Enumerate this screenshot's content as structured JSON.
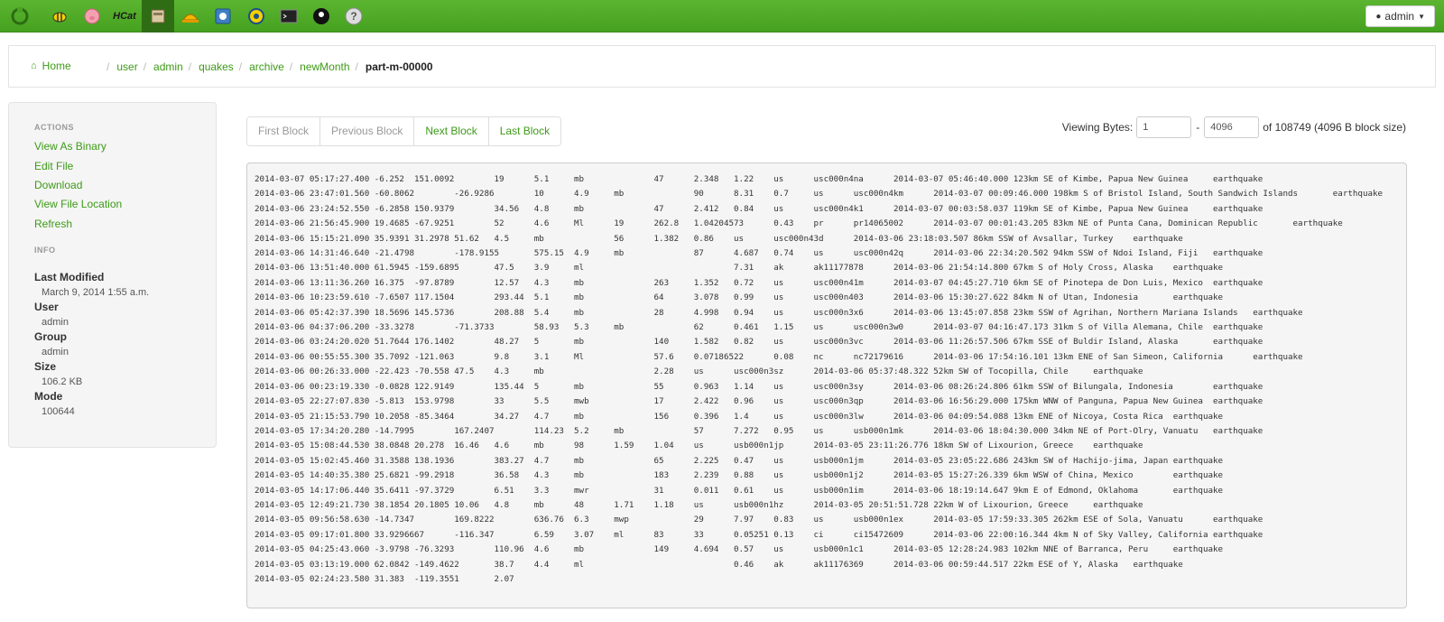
{
  "topbar": {
    "apps": [
      {
        "name": "hue-logo-icon"
      },
      {
        "name": "hive-bee-icon"
      },
      {
        "name": "pig-icon"
      },
      {
        "name": "hcat-icon",
        "label": "HCat"
      },
      {
        "name": "file-browser-icon"
      },
      {
        "name": "job-designer-icon"
      },
      {
        "name": "oozie-icon"
      },
      {
        "name": "job-browser-icon"
      },
      {
        "name": "shell-icon"
      },
      {
        "name": "user-admin-icon"
      },
      {
        "name": "help-icon"
      }
    ],
    "user_label": "admin"
  },
  "breadcrumb": {
    "home": "Home",
    "parts": [
      "user",
      "admin",
      "quakes",
      "archive",
      "newMonth"
    ],
    "current": "part-m-00000"
  },
  "sidebar": {
    "actions_heading": "ACTIONS",
    "actions": [
      "View As Binary",
      "Edit File",
      "Download",
      "View File Location",
      "Refresh"
    ],
    "info_heading": "INFO",
    "info": [
      {
        "label": "Last Modified",
        "value": "March 9, 2014 1:55 a.m."
      },
      {
        "label": "User",
        "value": "admin"
      },
      {
        "label": "Group",
        "value": "admin"
      },
      {
        "label": "Size",
        "value": "106.2 KB"
      },
      {
        "label": "Mode",
        "value": "100644"
      }
    ]
  },
  "pager": {
    "first": "First Block",
    "previous": "Previous Block",
    "next": "Next Block",
    "last": "Last Block"
  },
  "viewing": {
    "label": "Viewing Bytes:",
    "from": "1",
    "to": "4096",
    "suffix": "of 108749 (4096 B block size)"
  },
  "file_content": "2014-03-07 05:17:27.400 -6.252  151.0092        19      5.1     mb              47      2.348   1.22    us      usc000n4na      2014-03-07 05:46:40.000 123km SE of Kimbe, Papua New Guinea     earthquake\n2014-03-06 23:47:01.560 -60.8062        -26.9286        10      4.9     mb              90      8.31    0.7     us      usc000n4km      2014-03-07 00:09:46.000 198km S of Bristol Island, South Sandwich Islands       earthquake\n2014-03-06 23:24:52.550 -6.2858 150.9379        34.56   4.8     mb              47      2.412   0.84    us      usc000n4k1      2014-03-07 00:03:58.037 119km SE of Kimbe, Papua New Guinea     earthquake\n2014-03-06 21:56:45.900 19.4685 -67.9251        52      4.6     Ml      19      262.8   1.04204573      0.43    pr      pr14065002      2014-03-07 00:01:43.205 83km NE of Punta Cana, Dominican Republic       earthquake\n2014-03-06 15:15:21.090 35.9391 31.2978 51.62   4.5     mb              56      1.382   0.86    us      usc000n43d      2014-03-06 23:18:03.507 86km SSW of Avsallar, Turkey    earthquake\n2014-03-06 14:31:46.640 -21.4798        -178.9155       575.15  4.9     mb              87      4.687   0.74    us      usc000n42q      2014-03-06 22:34:20.502 94km SSW of Ndoi Island, Fiji   earthquake\n2014-03-06 13:51:40.000 61.5945 -159.6895       47.5    3.9     ml                              7.31    ak      ak11177878      2014-03-06 21:54:14.800 67km S of Holy Cross, Alaska    earthquake\n2014-03-06 13:11:36.260 16.375  -97.8789        12.57   4.3     mb              263     1.352   0.72    us      usc000n41m      2014-03-07 04:45:27.710 6km SE of Pinotepa de Don Luis, Mexico  earthquake\n2014-03-06 10:23:59.610 -7.6507 117.1504        293.44  5.1     mb              64      3.078   0.99    us      usc000n403      2014-03-06 15:30:27.622 84km N of Utan, Indonesia       earthquake\n2014-03-06 05:42:37.390 18.5696 145.5736        208.88  5.4     mb              28      4.998   0.94    us      usc000n3x6      2014-03-06 13:45:07.858 23km SSW of Agrihan, Northern Mariana Islands   earthquake\n2014-03-06 04:37:06.200 -33.3278        -71.3733        58.93   5.3     mb              62      0.461   1.15    us      usc000n3w0      2014-03-07 04:16:47.173 31km S of Villa Alemana, Chile  earthquake\n2014-03-06 03:24:20.020 51.7644 176.1402        48.27   5       mb              140     1.582   0.82    us      usc000n3vc      2014-03-06 11:26:57.506 67km SSE of Buldir Island, Alaska       earthquake\n2014-03-06 00:55:55.300 35.7092 -121.063        9.8     3.1     Ml              57.6    0.07186522      0.08    nc      nc72179616      2014-03-06 17:54:16.101 13km ENE of San Simeon, California      earthquake\n2014-03-06 00:26:33.000 -22.423 -70.558 47.5    4.3     mb                      2.28    us      usc000n3sz      2014-03-06 05:37:48.322 52km SW of Tocopilla, Chile     earthquake\n2014-03-06 00:23:19.330 -0.0828 122.9149        135.44  5       mb              55      0.963   1.14    us      usc000n3sy      2014-03-06 08:26:24.806 61km SSW of Bilungala, Indonesia        earthquake\n2014-03-05 22:27:07.830 -5.813  153.9798        33      5.5     mwb             17      2.422   0.96    us      usc000n3qp      2014-03-06 16:56:29.000 175km WNW of Panguna, Papua New Guinea  earthquake\n2014-03-05 21:15:53.790 10.2058 -85.3464        34.27   4.7     mb              156     0.396   1.4     us      usc000n3lw      2014-03-06 04:09:54.088 13km ENE of Nicoya, Costa Rica  earthquake\n2014-03-05 17:34:20.280 -14.7995        167.2407        114.23  5.2     mb              57      7.272   0.95    us      usb000n1mk      2014-03-06 18:04:30.000 34km NE of Port-Olry, Vanuatu   earthquake\n2014-03-05 15:08:44.530 38.0848 20.278  16.46   4.6     mb      98      1.59    1.04    us      usb000n1jp      2014-03-05 23:11:26.776 18km SW of Lixourion, Greece    earthquake\n2014-03-05 15:02:45.460 31.3588 138.1936        383.27  4.7     mb              65      2.225   0.47    us      usb000n1jm      2014-03-05 23:05:22.686 243km SW of Hachijo-jima, Japan earthquake\n2014-03-05 14:40:35.380 25.6821 -99.2918        36.58   4.3     mb              183     2.239   0.88    us      usb000n1j2      2014-03-05 15:27:26.339 6km WSW of China, Mexico        earthquake\n2014-03-05 14:17:06.440 35.6411 -97.3729        6.51    3.3     mwr             31      0.011   0.61    us      usb000n1im      2014-03-06 18:19:14.647 9km E of Edmond, Oklahoma       earthquake\n2014-03-05 12:49:21.730 38.1854 20.1805 10.06   4.8     mb      48      1.71    1.18    us      usb000n1hz      2014-03-05 20:51:51.728 22km W of Lixourion, Greece     earthquake\n2014-03-05 09:56:58.630 -14.7347        169.8222        636.76  6.3     mwp             29      7.97    0.83    us      usb000n1ex      2014-03-05 17:59:33.305 262km ESE of Sola, Vanuatu      earthquake\n2014-03-05 09:17:01.800 33.9296667      -116.347        6.59    3.07    ml      83      33      0.05251 0.13    ci      ci15472609      2014-03-06 22:00:16.344 4km N of Sky Valley, California earthquake\n2014-03-05 04:25:43.060 -3.9798 -76.3293        110.96  4.6     mb              149     4.694   0.57    us      usb000n1c1      2014-03-05 12:28:24.983 102km NNE of Barranca, Peru     earthquake\n2014-03-05 03:13:19.000 62.0842 -149.4622       38.7    4.4     ml                              0.46    ak      ak11176369      2014-03-06 00:59:44.517 22km ESE of Y, Alaska   earthquake\n2014-03-05 02:24:23.580 31.383  -119.3551       2.07"
}
